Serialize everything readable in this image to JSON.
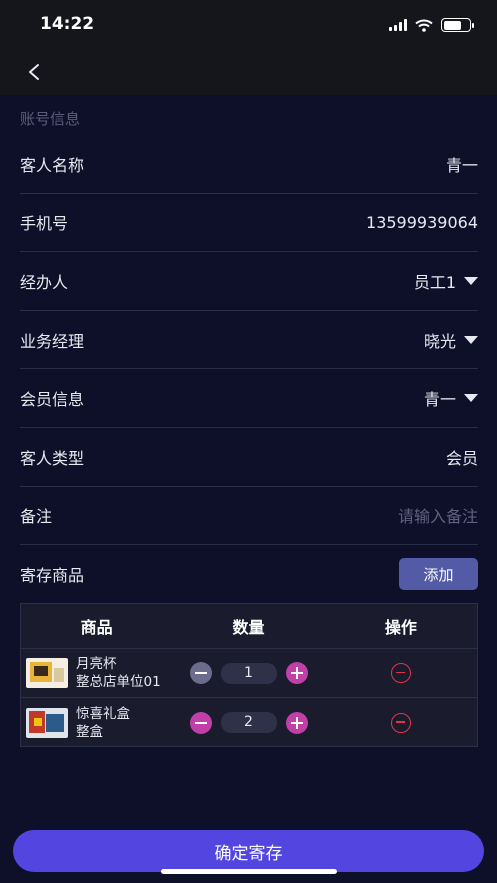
{
  "status_bar": {
    "time": "14:22"
  },
  "section_title": "账号信息",
  "form": [
    {
      "label": "客人名称",
      "value": "青一",
      "dropdown": false
    },
    {
      "label": "手机号",
      "value": "13599939064",
      "dropdown": false
    },
    {
      "label": "经办人",
      "value": "员工1",
      "dropdown": true
    },
    {
      "label": "业务经理",
      "value": "晓光",
      "dropdown": true
    },
    {
      "label": "会员信息",
      "value": "青一",
      "dropdown": true
    },
    {
      "label": "客人类型",
      "value": "会员",
      "dropdown": false
    }
  ],
  "remark": {
    "label": "备注",
    "placeholder": "请输入备注"
  },
  "goods": {
    "label": "寄存商品",
    "add_label": "添加"
  },
  "table": {
    "headers": [
      "商品",
      "数量",
      "操作"
    ],
    "rows": [
      {
        "name": "月亮杯",
        "unit": "整总店单位01",
        "qty": "1"
      },
      {
        "name": "惊喜礼盒",
        "unit": "整盒",
        "qty": "2"
      }
    ]
  },
  "confirm_label": "确定寄存",
  "colors": {
    "background": "#0e1029",
    "accent": "#5346e0",
    "button": "#535aa6",
    "stepper": "#c040a8",
    "delete": "#e0344a"
  }
}
